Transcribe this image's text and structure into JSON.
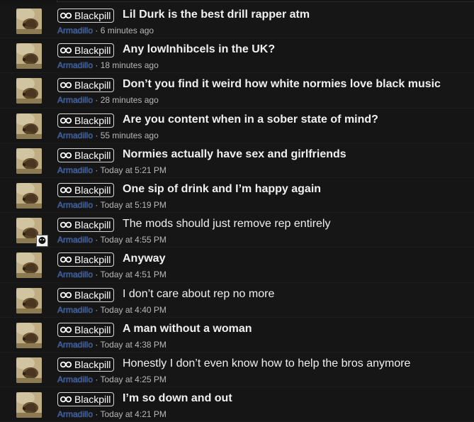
{
  "prefix_label": "Blackpill",
  "threads": [
    {
      "title": "Lil Durk is the best drill rapper atm",
      "author": "Armadillo",
      "time": "6 minutes ago",
      "bold": true
    },
    {
      "title": "Any lowInhibcels in the UK?",
      "author": "Armadillo",
      "time": "18 minutes ago",
      "bold": true
    },
    {
      "title": "Don’t you find it weird how white normies love black music",
      "author": "Armadillo",
      "time": "28 minutes ago",
      "bold": true
    },
    {
      "title": "Are you content when in a sober state of mind?",
      "author": "Armadillo",
      "time": "55 minutes ago",
      "bold": true
    },
    {
      "title": "Normies actually have sex and girlfriends",
      "author": "Armadillo",
      "time": "Today at 5:21 PM",
      "bold": true
    },
    {
      "title": "One sip of drink and I’m happy again",
      "author": "Armadillo",
      "time": "Today at 5:19 PM",
      "bold": true
    },
    {
      "title": "The mods should just remove rep entirely",
      "author": "Armadillo",
      "time": "Today at 4:55 PM",
      "bold": false,
      "has_reply_avatar": true
    },
    {
      "title": "Anyway",
      "author": "Armadillo",
      "time": "Today at 4:51 PM",
      "bold": true
    },
    {
      "title": "I don’t care about rep no more",
      "author": "Armadillo",
      "time": "Today at 4:40 PM",
      "bold": false
    },
    {
      "title": "A man without a woman",
      "author": "Armadillo",
      "time": "Today at 4:38 PM",
      "bold": true
    },
    {
      "title": "Honestly I don’t even know how to help the bros anymore",
      "author": "Armadillo",
      "time": "Today at 4:25 PM",
      "bold": false
    },
    {
      "title": "I’m so down and out",
      "author": "Armadillo",
      "time": "Today at 4:21 PM",
      "bold": true
    }
  ],
  "separator": "·",
  "icons": {
    "prefix": "pill-glasses-icon",
    "avatar": "armadillo-avatar"
  }
}
